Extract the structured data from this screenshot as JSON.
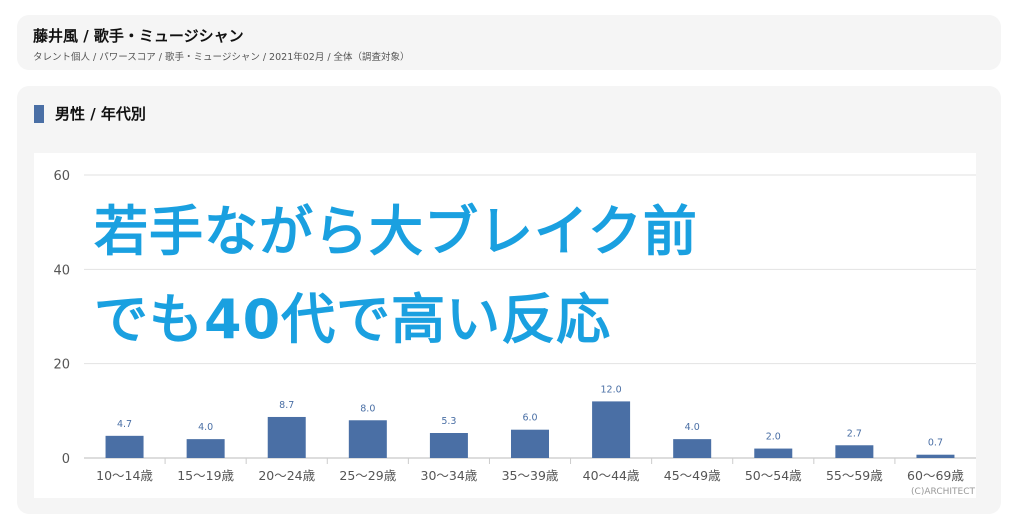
{
  "header": {
    "title": "藤井風 / 歌手・ミュージシャン",
    "breadcrumb": "タレント個人 / パワースコア / 歌手・ミュージシャン / 2021年02月 / 全体（調査対象）"
  },
  "section": {
    "title": "男性 / 年代別"
  },
  "overlay": {
    "line1": "若手ながら大ブレイク前",
    "line2": "でも40代で高い反応"
  },
  "copyright": "(C)ARCHITECT",
  "colors": {
    "bar": "#4a6fa5",
    "overlay_text": "#1aa0e0",
    "grid": "#e2e2e2"
  },
  "chart_data": {
    "type": "bar",
    "categories": [
      "10〜14歳",
      "15〜19歳",
      "20〜24歳",
      "25〜29歳",
      "30〜34歳",
      "35〜39歳",
      "40〜44歳",
      "45〜49歳",
      "50〜54歳",
      "55〜59歳",
      "60〜69歳"
    ],
    "values": [
      4.7,
      4.0,
      8.7,
      8.0,
      5.3,
      6.0,
      12.0,
      4.0,
      2.0,
      2.7,
      0.7
    ],
    "value_labels": [
      "4.7",
      "4.0",
      "8.7",
      "8.0",
      "5.3",
      "6.0",
      "12.0",
      "4.0",
      "2.0",
      "2.7",
      "0.7"
    ],
    "yticks": [
      "0",
      "20",
      "40",
      "60"
    ],
    "ylim": [
      0,
      60
    ],
    "grid": true
  }
}
